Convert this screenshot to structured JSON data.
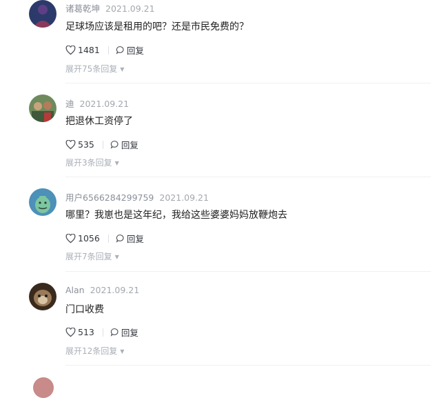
{
  "comments": [
    {
      "user": "诸葛乾坤",
      "date": "2021.09.21",
      "text": "足球场应该是租用的吧？还是市民免费的？",
      "likes": "1481",
      "reply_label": "回复",
      "expand_label": "展开75条回复"
    },
    {
      "user": "迪",
      "date": "2021.09.21",
      "text": "把退休工资停了",
      "likes": "535",
      "reply_label": "回复",
      "expand_label": "展开3条回复"
    },
    {
      "user": "用户6566284299759",
      "date": "2021.09.21",
      "text": "哪里？我崽也是这年纪，我给这些婆婆妈妈放鞭炮去",
      "likes": "1056",
      "reply_label": "回复",
      "expand_label": "展开7条回复"
    },
    {
      "user": "Alan",
      "date": "2021.09.21",
      "text": "门口收费",
      "likes": "513",
      "reply_label": "回复",
      "expand_label": "展开12条回复"
    }
  ],
  "colors": {
    "text": "#222222",
    "meta": "#8a8f99",
    "divider": "#eef0f3"
  },
  "icons": {
    "like": "heart-outline-icon",
    "reply": "speech-bubble-icon",
    "expand": "caret-down-icon"
  }
}
